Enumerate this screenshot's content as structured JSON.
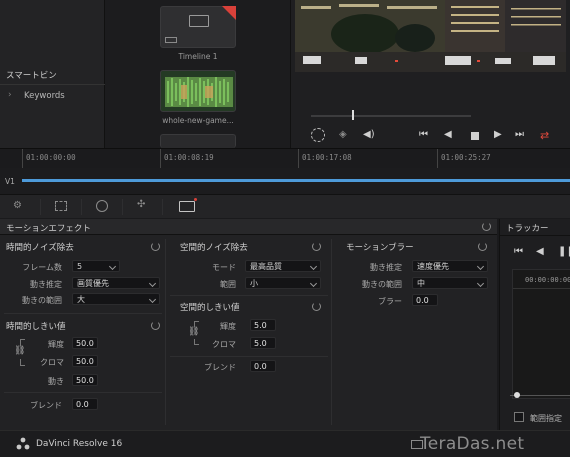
{
  "smart_bins": {
    "title": "スマートビン",
    "items": [
      {
        "label": "Keywords"
      }
    ]
  },
  "media_pool": {
    "clips": [
      {
        "name": "Timeline 1"
      },
      {
        "name": "whole-new-game..."
      }
    ]
  },
  "timeline": {
    "ticks": [
      "01:00:00:00",
      "01:00:08:19",
      "01:00:17:08",
      "01:00:25:27"
    ],
    "track": "V1"
  },
  "effects": {
    "panel_title": "モーションエフェクト",
    "temporal_nr": {
      "title": "時間的ノイズ除去",
      "frames_label": "フレーム数",
      "frames_value": "5",
      "motion_est_label": "動き推定",
      "motion_est_value": "画質優先",
      "motion_range_label": "動きの範囲",
      "motion_range_value": "大"
    },
    "temporal_threshold": {
      "title": "時間的しきい値",
      "luma_label": "輝度",
      "luma_value": "50.0",
      "chroma_label": "クロマ",
      "chroma_value": "50.0",
      "motion_label": "動き",
      "motion_value": "50.0",
      "blend_label": "ブレンド",
      "blend_value": "0.0"
    },
    "spatial_nr": {
      "title": "空間的ノイズ除去",
      "mode_label": "モード",
      "mode_value": "最高品質",
      "radius_label": "範囲",
      "radius_value": "小"
    },
    "spatial_threshold": {
      "title": "空間的しきい値",
      "luma_label": "輝度",
      "luma_value": "5.0",
      "chroma_label": "クロマ",
      "chroma_value": "5.0",
      "blend_label": "ブレンド",
      "blend_value": "0.0"
    },
    "motion_blur": {
      "title": "モーションブラー",
      "motion_est_label": "動き推定",
      "motion_est_value": "速度優先",
      "motion_range_label": "動きの範囲",
      "motion_range_value": "中",
      "blur_label": "ブラー",
      "blur_value": "0.0"
    }
  },
  "tracker": {
    "title": "トラッカー",
    "timecode": "00:00:00:00",
    "range_label": "範囲指定"
  },
  "status": {
    "app": "DaVinci Resolve 16",
    "watermark": "TeraDas.net"
  }
}
